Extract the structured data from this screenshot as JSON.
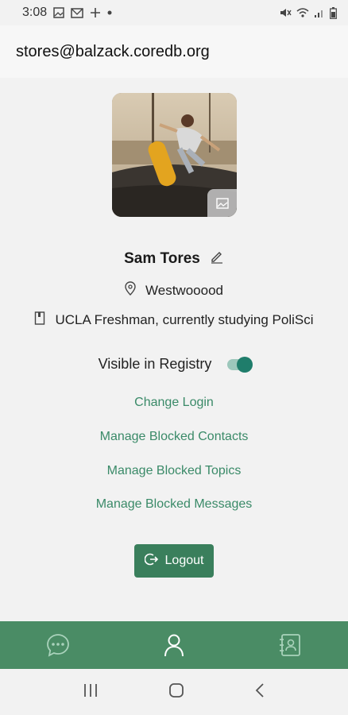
{
  "status_bar": {
    "time": "3:08",
    "left_icons": [
      "image-icon",
      "mail-icon",
      "plus-icon",
      "dot-icon"
    ],
    "right_icons": [
      "mute-icon",
      "wifi-icon",
      "signal-icon",
      "battery-icon"
    ]
  },
  "header": {
    "email": "stores@balzack.coredb.org"
  },
  "profile": {
    "name": "Sam Tores",
    "location": "Westwooood",
    "description": "UCLA Freshman, currently studying PoliSci"
  },
  "registry": {
    "label": "Visible in Registry",
    "enabled": true
  },
  "links": {
    "change_login": "Change Login",
    "blocked_contacts": "Manage Blocked Contacts",
    "blocked_topics": "Manage Blocked Topics",
    "blocked_messages": "Manage Blocked Messages"
  },
  "logout": {
    "label": "Logout"
  },
  "bottom_nav": {
    "items": [
      "chat-icon",
      "profile-icon",
      "contacts-icon"
    ],
    "active": "profile-icon"
  },
  "colors": {
    "accent": "#3a8a68",
    "nav": "#4a8c65",
    "toggle": "#1f7d6b"
  }
}
